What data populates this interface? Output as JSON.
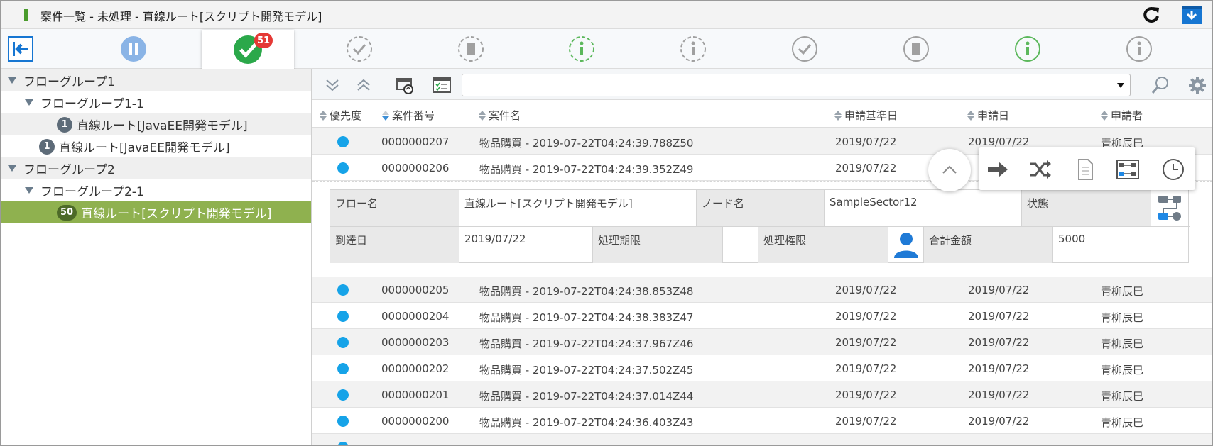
{
  "window": {
    "title": "案件一覧 - 未処理 - 直線ルート[スクリプト開発モデル]",
    "reload_icon": "reload-icon",
    "download_icon": "download-icon"
  },
  "toolbar": {
    "back_icon": "exit-left-icon",
    "pause_icon": "pause-icon",
    "active_badge": "51",
    "icons": [
      "pause-icon",
      "check-circle-icon",
      "dashed-check-icon",
      "dashed-document-icon",
      "dashed-info-green-icon",
      "dashed-info-icon",
      "check-icon",
      "document-icon",
      "info-green-icon",
      "info-icon"
    ]
  },
  "sidebar": {
    "items": [
      {
        "label": "フローグループ1",
        "type": "group"
      },
      {
        "label": "フローグループ1-1",
        "type": "group"
      },
      {
        "label": "直線ルート[JavaEE開発モデル]",
        "count": "1"
      },
      {
        "label": "直線ルート[JavaEE開発モデル]",
        "count": "1"
      },
      {
        "label": "フローグループ2",
        "type": "group"
      },
      {
        "label": "フローグループ2-1",
        "type": "group"
      },
      {
        "label": "直線ルート[スクリプト開発モデル]",
        "count": "50"
      }
    ]
  },
  "filter": {
    "expand_all_icon": "double-chevron-down-icon",
    "collapse_all_icon": "double-chevron-up-icon",
    "refresh_icon": "refresh-list-icon",
    "checklist_icon": "checklist-icon",
    "search_icon": "search-icon",
    "settings_icon": "gear-icon",
    "select_value": ""
  },
  "table": {
    "headers": {
      "priority": "優先度",
      "number": "案件番号",
      "name": "案件名",
      "base_date": "申請基準日",
      "apply_date": "申請日",
      "applicant": "申請者"
    },
    "rows": [
      {
        "number": "0000000207",
        "name": "物品購買 - 2019-07-22T04:24:39.788Z50",
        "base_date": "2019/07/22",
        "apply_date": "2019/07/22",
        "applicant": "青柳辰巳"
      },
      {
        "number": "0000000206",
        "name": "物品購買 - 2019-07-22T04:24:39.352Z49",
        "base_date": "2019/07/22",
        "apply_date": "2",
        "applicant": ""
      },
      {
        "number": "0000000205",
        "name": "物品購買 - 2019-07-22T04:24:38.853Z48",
        "base_date": "2019/07/22",
        "apply_date": "2019/07/22",
        "applicant": "青柳辰巳"
      },
      {
        "number": "0000000204",
        "name": "物品購買 - 2019-07-22T04:24:38.383Z47",
        "base_date": "2019/07/22",
        "apply_date": "2019/07/22",
        "applicant": "青柳辰巳"
      },
      {
        "number": "0000000203",
        "name": "物品購買 - 2019-07-22T04:24:37.967Z46",
        "base_date": "2019/07/22",
        "apply_date": "2019/07/22",
        "applicant": "青柳辰巳"
      },
      {
        "number": "0000000202",
        "name": "物品購買 - 2019-07-22T04:24:37.502Z45",
        "base_date": "2019/07/22",
        "apply_date": "2019/07/22",
        "applicant": "青柳辰巳"
      },
      {
        "number": "0000000201",
        "name": "物品購買 - 2019-07-22T04:24:37.014Z44",
        "base_date": "2019/07/22",
        "apply_date": "2019/07/22",
        "applicant": "青柳辰巳"
      },
      {
        "number": "0000000200",
        "name": "物品購買 - 2019-07-22T04:24:36.403Z43",
        "base_date": "2019/07/22",
        "apply_date": "2019/07/22",
        "applicant": "青柳辰巳"
      }
    ]
  },
  "detail": {
    "flow_label": "フロー名",
    "flow_value": "直線ルート[スクリプト開発モデル]",
    "node_label": "ノード名",
    "node_value": "SampleSector12",
    "status_label": "状態",
    "arrival_label": "到達日",
    "arrival_value": "2019/07/22",
    "deadline_label": "処理期限",
    "deadline_value": "",
    "authority_label": "処理権限",
    "total_label": "合計金額",
    "total_value": "5000"
  },
  "actions": {
    "collapse_icon": "chevron-up-icon",
    "items": [
      "arrow-right-icon",
      "shuffle-icon",
      "document-icon",
      "flow-diagram-icon",
      "clock-icon"
    ]
  },
  "colors": {
    "accent_green": "#8fb14f",
    "priority_dot": "#16a3e8",
    "badge_red": "#e53935",
    "link_blue": "#1676d2"
  }
}
